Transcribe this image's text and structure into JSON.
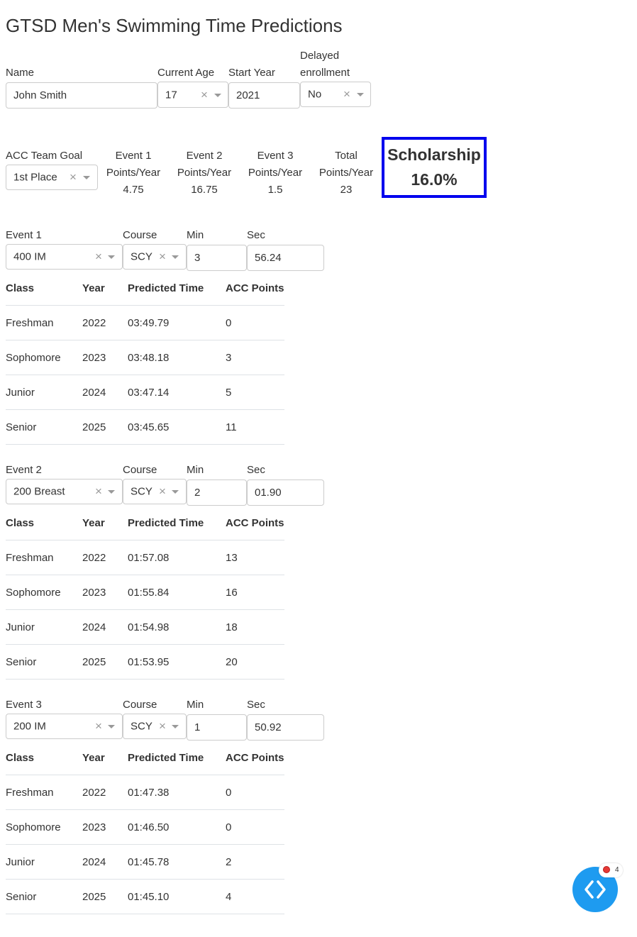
{
  "title": "GTSD Men's Swimming Time Predictions",
  "form": {
    "name_label": "Name",
    "name_value": "John Smith",
    "age_label": "Current Age",
    "age_value": "17",
    "start_label": "Start Year",
    "start_value": "2021",
    "delayed_label_1": "Delayed",
    "delayed_label_2": "enrollment",
    "delayed_value": "No"
  },
  "goal": {
    "label": "ACC Team Goal",
    "value": "1st Place"
  },
  "summary": [
    {
      "line1": "Event 1",
      "line2": "Points/Year",
      "value": "4.75"
    },
    {
      "line1": "Event 2",
      "line2": "Points/Year",
      "value": "16.75"
    },
    {
      "line1": "Event 3",
      "line2": "Points/Year",
      "value": "1.5"
    },
    {
      "line1": "Total",
      "line2": "Points/Year",
      "value": "23"
    }
  ],
  "scholarship": {
    "label": "Scholarship",
    "value": "16.0%",
    "border_color": "#0000ee"
  },
  "event_labels": {
    "course": "Course",
    "min": "Min",
    "sec": "Sec"
  },
  "table_headers": [
    "Class",
    "Year",
    "Predicted Time",
    "ACC Points"
  ],
  "events": [
    {
      "label": "Event 1",
      "event": "400 IM",
      "course": "SCY",
      "min": "3",
      "sec": "56.24",
      "rows": [
        {
          "cls": "Freshman",
          "year": "2022",
          "time": "03:49.79",
          "points": "0"
        },
        {
          "cls": "Sophomore",
          "year": "2023",
          "time": "03:48.18",
          "points": "3"
        },
        {
          "cls": "Junior",
          "year": "2024",
          "time": "03:47.14",
          "points": "5"
        },
        {
          "cls": "Senior",
          "year": "2025",
          "time": "03:45.65",
          "points": "11"
        }
      ]
    },
    {
      "label": "Event 2",
      "event": "200 Breast",
      "course": "SCY",
      "min": "2",
      "sec": "01.90",
      "rows": [
        {
          "cls": "Freshman",
          "year": "2022",
          "time": "01:57.08",
          "points": "13"
        },
        {
          "cls": "Sophomore",
          "year": "2023",
          "time": "01:55.84",
          "points": "16"
        },
        {
          "cls": "Junior",
          "year": "2024",
          "time": "01:54.98",
          "points": "18"
        },
        {
          "cls": "Senior",
          "year": "2025",
          "time": "01:53.95",
          "points": "20"
        }
      ]
    },
    {
      "label": "Event 3",
      "event": "200 IM",
      "course": "SCY",
      "min": "1",
      "sec": "50.92",
      "rows": [
        {
          "cls": "Freshman",
          "year": "2022",
          "time": "01:47.38",
          "points": "0"
        },
        {
          "cls": "Sophomore",
          "year": "2023",
          "time": "01:46.50",
          "points": "0"
        },
        {
          "cls": "Junior",
          "year": "2024",
          "time": "01:45.78",
          "points": "2"
        },
        {
          "cls": "Senior",
          "year": "2025",
          "time": "01:45.10",
          "points": "4"
        }
      ]
    }
  ],
  "debug": {
    "badge_count": "4",
    "accent": "#1e9bf0",
    "icon": "code-brackets-icon"
  }
}
